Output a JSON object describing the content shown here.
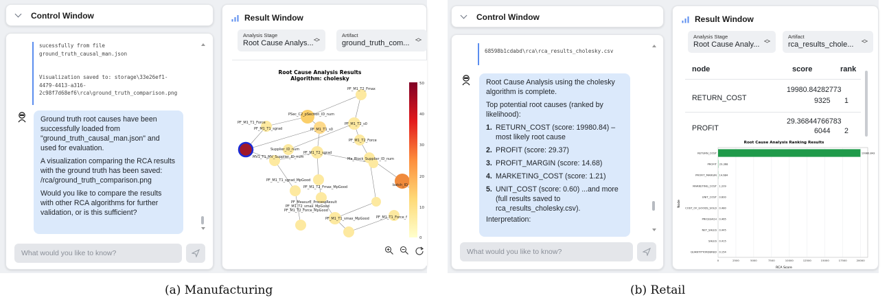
{
  "panel_a": {
    "control_title": "Control Window",
    "result_title": "Result Window",
    "code_lines": [
      "sucessfully from file",
      "ground_truth_causal_man.json",
      "",
      "",
      "Visualization saved to: storage\\33e26ef1-",
      "4479-4413-a316-",
      "2c98f7d68ef6\\rca\\ground_truth_comparison.png"
    ],
    "bubble": [
      "Ground truth root causes have been successfully loaded from \"ground_truth_causal_man.json\" and used for evaluation.",
      "A visualization comparing the RCA results with the ground truth has been saved: /rca/ground_truth_comparison.png",
      "Would you like to compare the results with other RCA algorithms for further validation, or is this sufficient?"
    ],
    "input_placeholder": "What would you like to know?",
    "analysis_stage_label": "Analysis Stage",
    "analysis_stage_value": "Root Cause Analys...",
    "artifact_label": "Artifact",
    "artifact_value": "ground_truth_com...",
    "graph_title_1": "Root Cause Analysis Results",
    "graph_title_2": "Algorithm: cholesky",
    "colorbar_ticks": [
      "50",
      "40",
      "30",
      "20",
      "10",
      "0"
    ],
    "nodes": [
      "PF_M1_T2_Fmax",
      "PSec_C2_pSection_ID_num",
      "PF_M1_T1_Force",
      "PF_M1_T1_sgrad",
      "PF_M1_T1_s0",
      "PF_M1_T2_s0",
      "PF_M1_T2_Force",
      "Supplier_ID_num",
      "MV1_T1_MV_Supplier_ID_num",
      "PF_M1_T2_sgrad",
      "PF_M1_T1_sgrad_MpGood",
      "PF_M1_T2_Fmax_MpGood",
      "PF_M1_T2_smax_MpGood",
      "PF_M1_T2_Force_MpGood",
      "PF_M1_T1_smax_MpGood",
      "PF_M1_T1_Force_f",
      "batch_ID_num",
      "Ma_Block_Supplier_ID_num",
      "PF_MeasurE_ProcessResult"
    ],
    "caption": "(a) Manufacturing"
  },
  "panel_b": {
    "control_title": "Control Window",
    "result_title": "Result Window",
    "code_line": "68598b1cdabd\\rca\\rca_results_cholesky.csv",
    "bubble_intro": "Root Cause Analysis using the cholesky algorithm is complete.",
    "bubble_sub": "Top potential root causes (ranked by likelihood):",
    "list": [
      {
        "num": "1.",
        "name": "RETURN_COST",
        "rest": " (score: 19980.84) – most likely root cause"
      },
      {
        "num": "2.",
        "name": "PROFIT",
        "rest": " (score: 29.37)"
      },
      {
        "num": "3.",
        "name": "PROFIT_MARGIN",
        "rest": " (score: 14.68)"
      },
      {
        "num": "4.",
        "name": "MARKETING_COST",
        "rest": " (score: 1.21)"
      },
      {
        "num": "5.",
        "name": "UNIT_COST",
        "rest": " (score: 0.60) ...and more (full results saved to rca_results_cholesky.csv)."
      }
    ],
    "bubble_tail": "Interpretation:",
    "input_placeholder": "What would you like to know?",
    "analysis_stage_label": "Analysis Stage",
    "analysis_stage_value": "Root Cause Analy...",
    "artifact_label": "Artifact",
    "artifact_value": "rca_results_chole...",
    "table": {
      "headers": [
        "node",
        "score",
        "rank"
      ],
      "rows": [
        {
          "node": "RETURN_COST",
          "score_1": "19980.84282773",
          "score_2": "9325",
          "rank": "1"
        },
        {
          "node": "PROFIT",
          "score_1": "29.36844766783",
          "score_2": "6044",
          "rank": "2"
        }
      ]
    },
    "caption": "(b) Retail"
  },
  "chart_data": {
    "type": "bar",
    "orientation": "horizontal",
    "title": "Root Cause Analysis Ranking Results",
    "xlabel": "RCA Score",
    "ylabel": "Node",
    "categories": [
      "RETURN_COST",
      "PROFIT",
      "PROFIT_MARGIN",
      "MARKETING_COST",
      "UNIT_COST",
      "COST_OF_GOODS_SOLD",
      "PRICEEACH",
      "NET_SALES",
      "SALES",
      "QUANTITYORDERED"
    ],
    "values": [
      19980.843,
      29.368,
      14.684,
      1.209,
      0.6,
      0.48,
      0.465,
      0.445,
      0.415,
      0.154
    ],
    "value_labels": [
      "19980.843",
      "29.368",
      "14.684",
      "1.209",
      "0.600",
      "0.480",
      "0.465",
      "0.445",
      "0.415",
      "0.154"
    ],
    "xticks": [
      "0",
      "2500",
      "5000",
      "7500",
      "10000",
      "12500",
      "15000",
      "17500",
      "20000"
    ],
    "xlim": [
      0,
      21000
    ],
    "grid": true,
    "bar_color": "#1f9a4a"
  }
}
